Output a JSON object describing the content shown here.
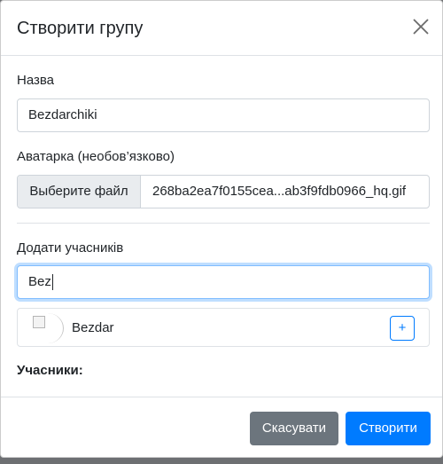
{
  "modal": {
    "title": "Створити групу"
  },
  "form": {
    "name_label": "Назва",
    "name_value": "Bezdarchiki",
    "avatar_label": "Аватарка (необов’язково)",
    "file_button_label": "Выберите файл",
    "file_name": "268ba2ea7f0155cea...ab3f9fdb0966_hq.gif",
    "add_members_label": "Додати учасників",
    "search_value": "Bez",
    "search_results": [
      {
        "name": "Bezdar",
        "add_label": "+"
      }
    ],
    "members_label": "Учасники:"
  },
  "footer": {
    "cancel_label": "Скасувати",
    "create_label": "Створити"
  },
  "colors": {
    "primary": "#007bff",
    "secondary": "#6c757d",
    "backdrop": "#6d6f72"
  },
  "icons": [
    "close-icon",
    "avatar-image-icon"
  ]
}
